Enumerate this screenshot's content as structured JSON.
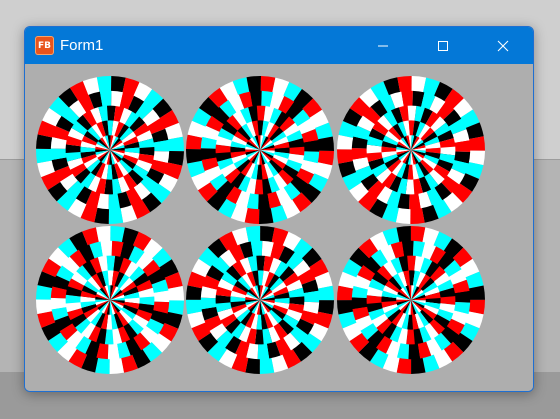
{
  "window": {
    "title": "Form1",
    "icon": "vb-app-icon",
    "icon_label": "FB",
    "controls": [
      "minimize-icon",
      "maximize-icon",
      "close-icon"
    ]
  },
  "canvas": {
    "disk_count": 6,
    "rings_per_disk": 5,
    "segments_per_ring": 32,
    "palette": [
      "#00ffff",
      "#ffffff",
      "#ff0000",
      "#000000"
    ],
    "background": "#aeaeae"
  },
  "colors": {
    "titlebar": "#0478d7",
    "window_border": "#1f6fd1"
  }
}
